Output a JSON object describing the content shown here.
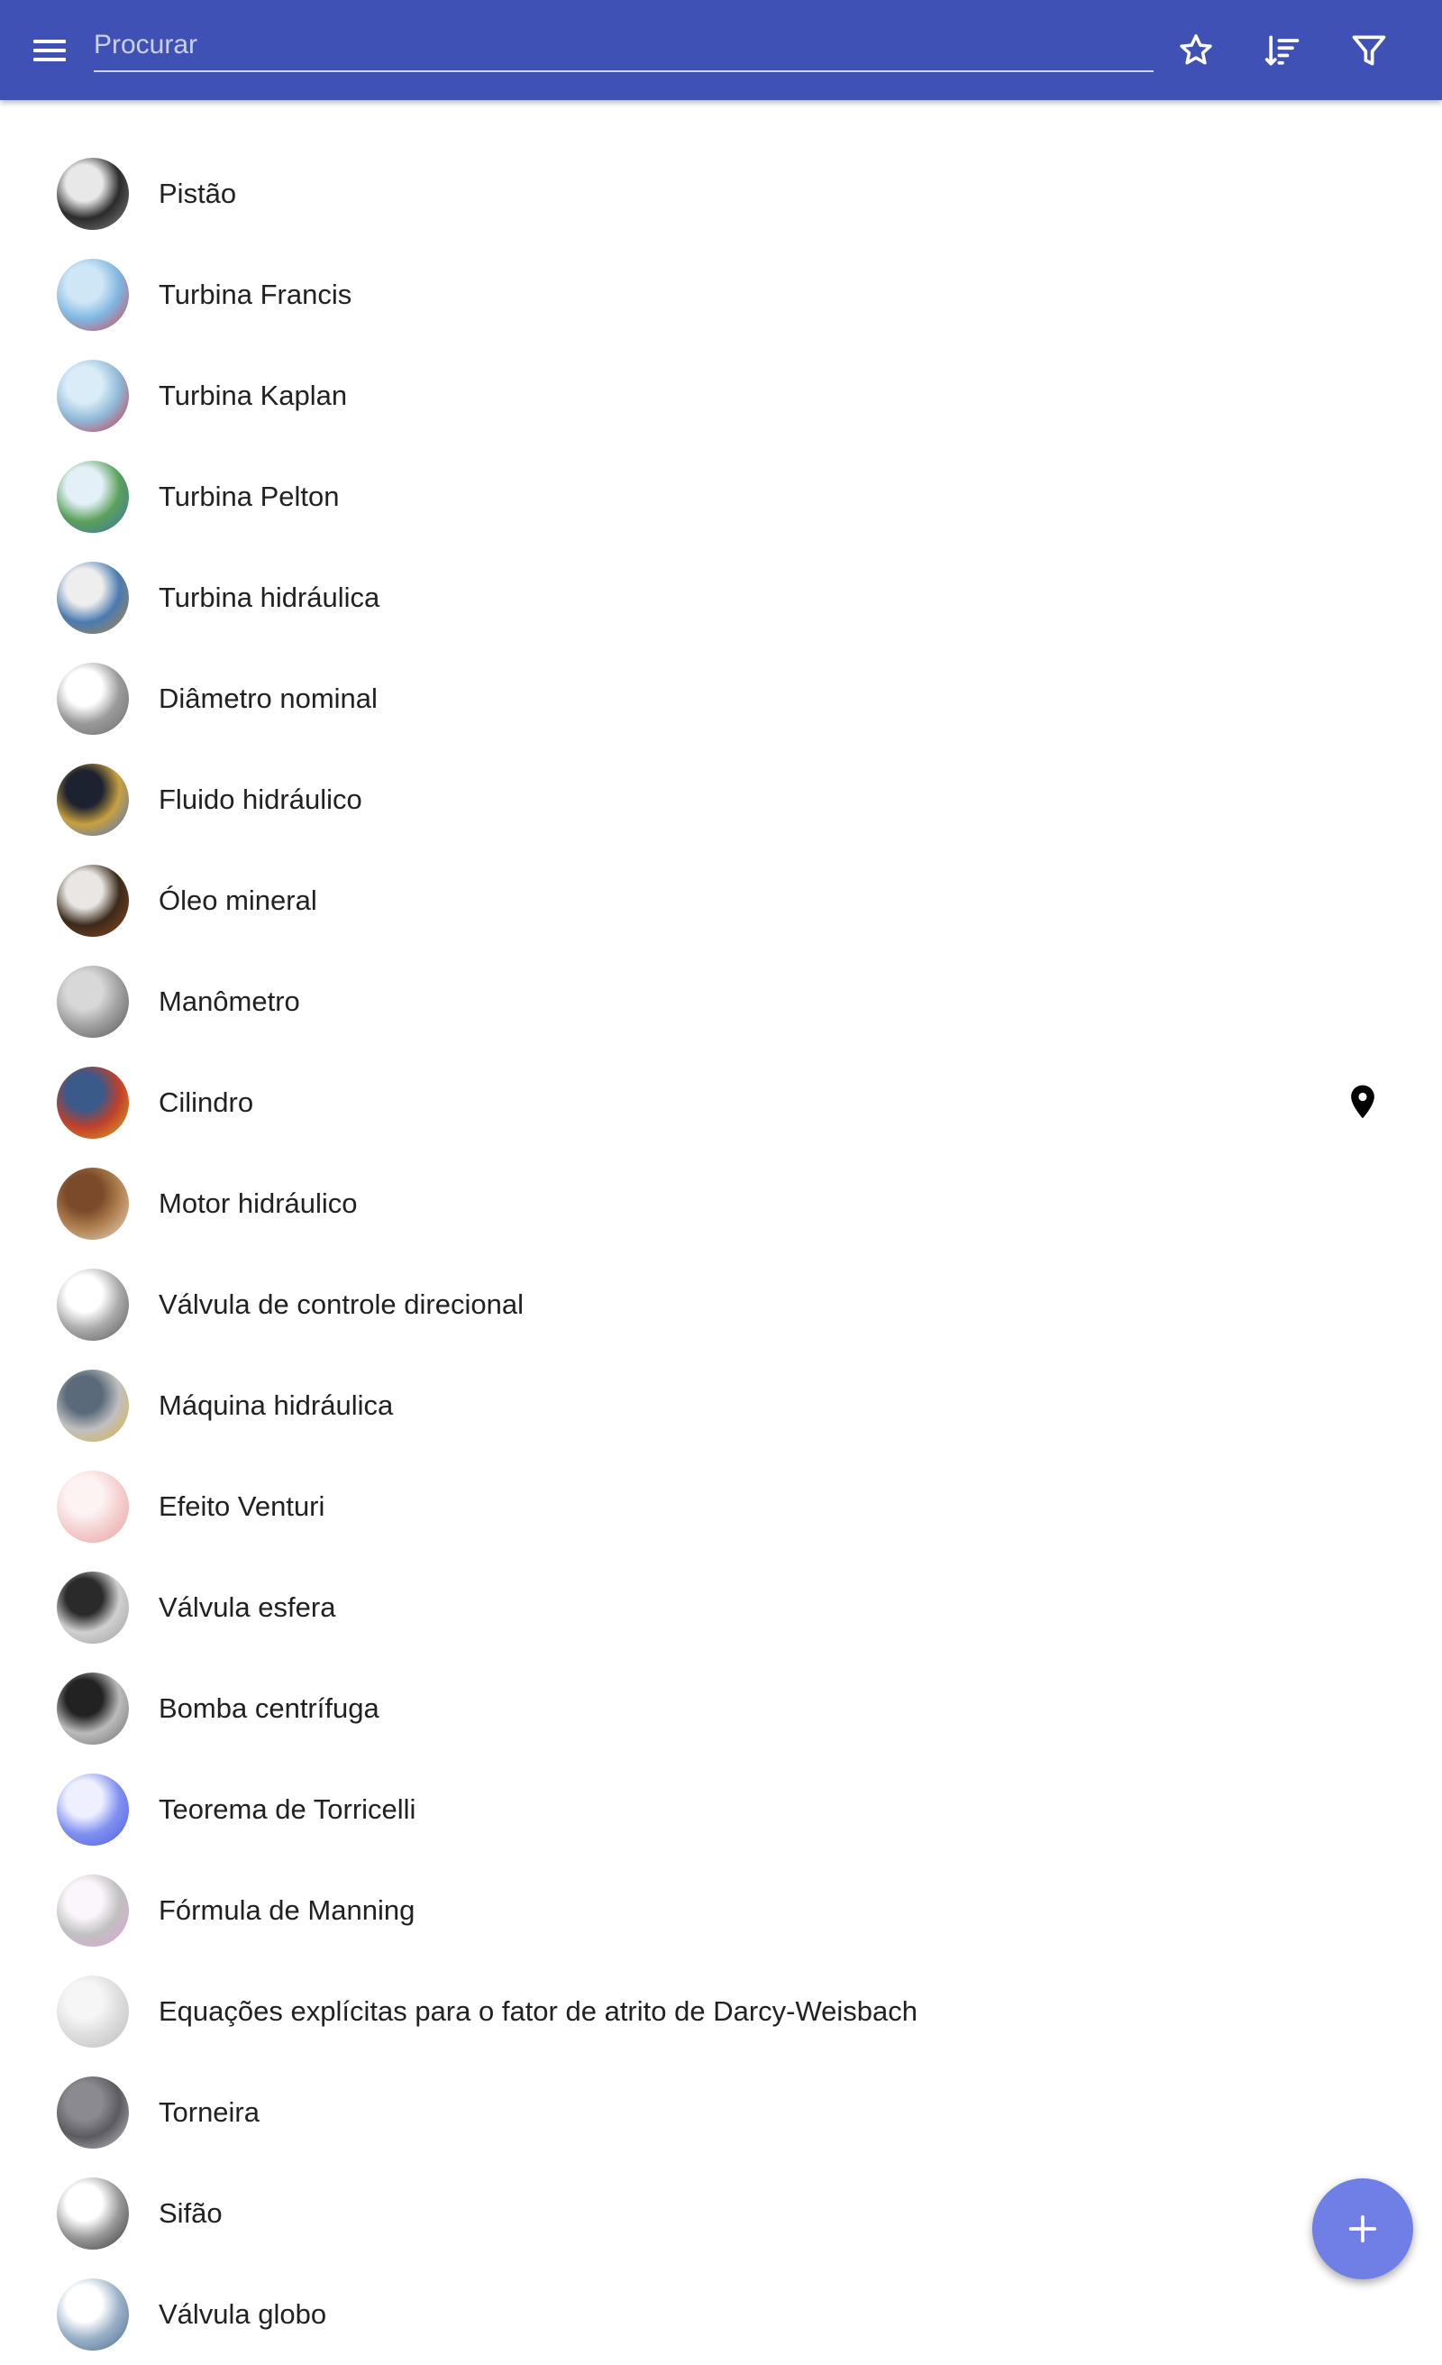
{
  "appbar": {
    "search_placeholder": "Procurar",
    "color": "#3f51b5"
  },
  "icons": {
    "menu": "menu-icon",
    "favorite": "star-outline-icon",
    "sort": "sort-icon",
    "filter": "filter-icon",
    "location": "map-pin-icon",
    "add": "plus-icon"
  },
  "items": [
    {
      "label": "Pistão",
      "thumb_colors": [
        "#e8e8e8",
        "#8a8a8a",
        "#2b2b2b"
      ]
    },
    {
      "label": "Turbina Francis",
      "thumb_colors": [
        "#cfe6f6",
        "#e23b4a",
        "#7fb6e0"
      ]
    },
    {
      "label": "Turbina Kaplan",
      "thumb_colors": [
        "#d9ecf7",
        "#d7263d",
        "#8fb9d8"
      ]
    },
    {
      "label": "Turbina Pelton",
      "thumb_colors": [
        "#e3f0f8",
        "#3a6fb0",
        "#5aa15a"
      ]
    },
    {
      "label": "Turbina hidráulica",
      "thumb_colors": [
        "#eeeeee",
        "#b98a3e",
        "#4a7ab0"
      ]
    },
    {
      "label": "Diâmetro nominal",
      "thumb_colors": [
        "#ffffff",
        "#6a6a6a",
        "#9a9a9a"
      ]
    },
    {
      "label": "Fluido hidráulico",
      "thumb_colors": [
        "#1d2230",
        "#3a6fd8",
        "#c8a040"
      ]
    },
    {
      "label": "Óleo mineral",
      "thumb_colors": [
        "#e9e6e3",
        "#9a4a1e",
        "#3b2a1a"
      ]
    },
    {
      "label": "Manômetro",
      "thumb_colors": [
        "#d8d8d8",
        "#555555",
        "#a0a0a0"
      ]
    },
    {
      "label": "Cilindro",
      "thumb_colors": [
        "#3a5a8a",
        "#e0b020",
        "#c0402a"
      ],
      "has_location": true
    },
    {
      "label": "Motor hidráulico",
      "thumb_colors": [
        "#7a4a2a",
        "#e8dcc8",
        "#b08050"
      ]
    },
    {
      "label": "Válvula de controle direcional",
      "thumb_colors": [
        "#ffffff",
        "#555555",
        "#aaaaaa"
      ]
    },
    {
      "label": "Máquina hidráulica",
      "thumb_colors": [
        "#5a6a7a",
        "#e0b030",
        "#c0c0c0"
      ]
    },
    {
      "label": "Efeito Venturi",
      "thumb_colors": [
        "#fdf3f3",
        "#e8a0a0",
        "#f5d0d0"
      ]
    },
    {
      "label": "Válvula esfera",
      "thumb_colors": [
        "#2a2a2a",
        "#9a9a9a",
        "#d0d0d0"
      ]
    },
    {
      "label": "Bomba centrífuga",
      "thumb_colors": [
        "#222222",
        "#6a6a6a",
        "#bbbbbb"
      ]
    },
    {
      "label": "Teorema de Torricelli",
      "thumb_colors": [
        "#eef0ff",
        "#4a5ae0",
        "#8090f0"
      ]
    },
    {
      "label": "Fórmula de Manning",
      "thumb_colors": [
        "#fbf6fb",
        "#e0a0d8",
        "#c0c0c0"
      ]
    },
    {
      "label": "Equações explícitas para o fator de atrito de Darcy-Weisbach",
      "thumb_colors": [
        "#f6f6f6",
        "#bbbbbb",
        "#dddddd"
      ]
    },
    {
      "label": "Torneira",
      "thumb_colors": [
        "#8a8a90",
        "#c8c8cc",
        "#5a5a60"
      ]
    },
    {
      "label": "Sifão",
      "thumb_colors": [
        "#ffffff",
        "#333333",
        "#999999"
      ]
    },
    {
      "label": "Válvula globo",
      "thumb_colors": [
        "#ffffff",
        "#4a6a8a",
        "#9ab0c8"
      ]
    }
  ],
  "fab": {
    "color": "#6f7fe6"
  }
}
